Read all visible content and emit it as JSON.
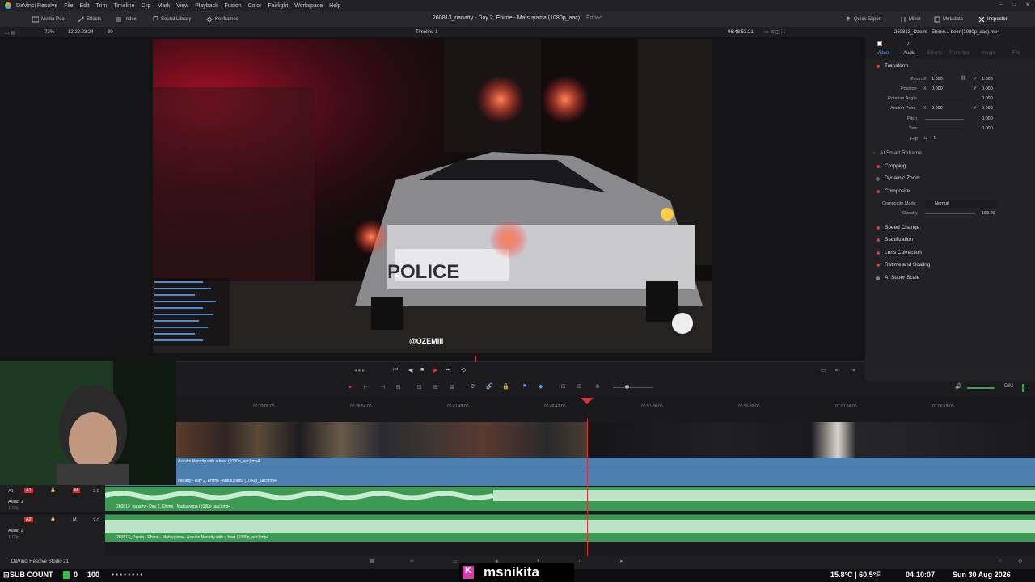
{
  "menubar": {
    "app": "DaVinci Resolve",
    "items": [
      "File",
      "Edit",
      "Trim",
      "Timeline",
      "Clip",
      "Mark",
      "View",
      "Playback",
      "Fusion",
      "Color",
      "Fairlight",
      "Workspace",
      "Help"
    ]
  },
  "toolbar": {
    "media_pool": "Media Pool",
    "effects": "Effects",
    "index": "Index",
    "sound_library": "Sound Library",
    "keyframes": "Keyframes",
    "project_title": "260813_nanatty - Day 2, Ehime - Matsuyama (1080p_aac)",
    "edited": "Edited",
    "quick_export": "Quick Export",
    "mixer": "Mixer",
    "metadata": "Metadata",
    "inspector": "Inspector"
  },
  "viewer": {
    "zoom": "72%",
    "timecode_left": "12:22:23:24",
    "fps": "30",
    "timeline_name": "Timeline 1",
    "timecode_right": "06:48:53:21",
    "clip_name": "260813_Ozemi - Ehime... beer (1080p_aac).mp4",
    "watermark": "@OZEMIII",
    "overlay_police": "POLICE"
  },
  "inspector": {
    "tabs": [
      "Video",
      "Audio",
      "Effects",
      "Transition",
      "Image",
      "File"
    ],
    "transform": "Transform",
    "zoom": {
      "label": "Zoom",
      "x": "1.000",
      "y": "1.000"
    },
    "position": {
      "label": "Position",
      "x": "0.000",
      "y": "0.000"
    },
    "rotation": {
      "label": "Rotation Angle",
      "value": "0.000"
    },
    "anchor": {
      "label": "Anchor Point",
      "x": "0.000",
      "y": "0.000"
    },
    "pitch": {
      "label": "Pitch",
      "value": "0.000"
    },
    "yaw": {
      "label": "Yaw",
      "value": "0.000"
    },
    "flip": {
      "label": "Flip"
    },
    "smart_reframe": "AI Smart Reframe",
    "cropping": "Cropping",
    "dynamic_zoom": "Dynamic Zoom",
    "composite": "Composite",
    "composite_mode": {
      "label": "Composite Mode",
      "value": "Normal"
    },
    "opacity": {
      "label": "Opacity",
      "value": "100.00"
    },
    "speed_change": "Speed Change",
    "stabilization": "Stabilization",
    "lens_correction": "Lens Correction",
    "retime_scaling": "Retime and Scaling",
    "super_scale": "AI Super Scale"
  },
  "ruler": {
    "ticks": [
      "06:32:00:00",
      "06:36:54:00",
      "06:41:48:00",
      "06:46:42:00",
      "06:51:36:00",
      "06:56:30:00",
      "07:01:24:00",
      "07:06:18:00"
    ]
  },
  "tracks": {
    "v_clip1": "Assults Nanatty with a beer (1080p_aac).mp4",
    "v_clip2": "nanatty - Day 2, Ehime - Matsuyama (1080p_aac).mp4",
    "a1_clip": "260813_nanatty - Day 2, Ehime - Matsuyama (1080p_aac).mp4",
    "a2_clip": "260813_Ozemi - Ehime - Matsuyama - Assults Nanatty with a beer (1080p_aac).mp4",
    "a1": {
      "tag": "A1",
      "name": "Audio 1",
      "sub": "1 Clip",
      "ch": "2.0"
    },
    "a2": {
      "tag": "A2",
      "name": "Audio 2",
      "sub": "1 Clip",
      "ch": "2.0"
    }
  },
  "footer": {
    "app_version": "DaVinci Resolve Studio 21"
  },
  "taskbar": {
    "sub_count_label": "SUB COUNT",
    "sub_count": "0",
    "sub_goal": "100",
    "streamer": "msnikita",
    "temperature": "15.8°C | 60.5°F",
    "clock": "04:10:07",
    "date": "Sun 30 Aug 2026"
  },
  "colors": {
    "accent_red": "#d03a3a",
    "video_track": "#4a7fb0",
    "audio_track": "#3d9a55",
    "playhead": "#e0303a"
  }
}
